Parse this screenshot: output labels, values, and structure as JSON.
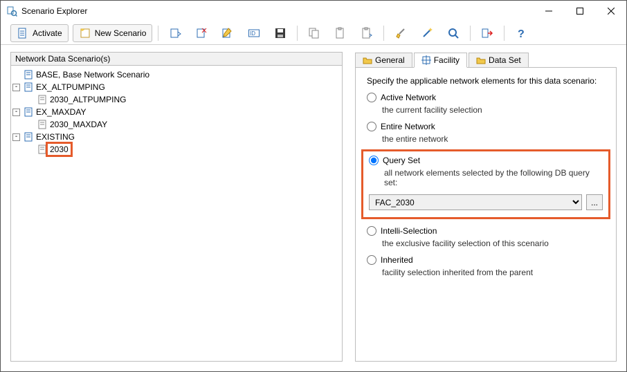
{
  "window": {
    "title": "Scenario Explorer"
  },
  "toolbar": {
    "activate": "Activate",
    "newScenario": "New Scenario"
  },
  "left": {
    "header": "Network Data Scenario(s)",
    "tree": {
      "root": "BASE, Base Network Scenario",
      "n1": "EX_ALTPUMPING",
      "n1a": "2030_ALTPUMPING",
      "n2": "EX_MAXDAY",
      "n2a": "2030_MAXDAY",
      "n3": "EXISTING",
      "n3a": "2030"
    },
    "expander": "-"
  },
  "tabs": {
    "general": "General",
    "facility": "Facility",
    "dataSet": "Data Set"
  },
  "facility": {
    "intro": "Specify the applicable network elements for this data scenario:",
    "active": {
      "label": "Active Network",
      "desc": "the current facility selection"
    },
    "entire": {
      "label": "Entire Network",
      "desc": "the entire network"
    },
    "query": {
      "label": "Query Set",
      "desc": "all network elements selected by the following DB query set:",
      "selected": "FAC_2030"
    },
    "intelli": {
      "label": "Intelli-Selection",
      "desc": "the exclusive facility selection of this scenario"
    },
    "inherit": {
      "label": "Inherited",
      "desc": "facility selection inherited from the parent"
    },
    "browse": "..."
  }
}
